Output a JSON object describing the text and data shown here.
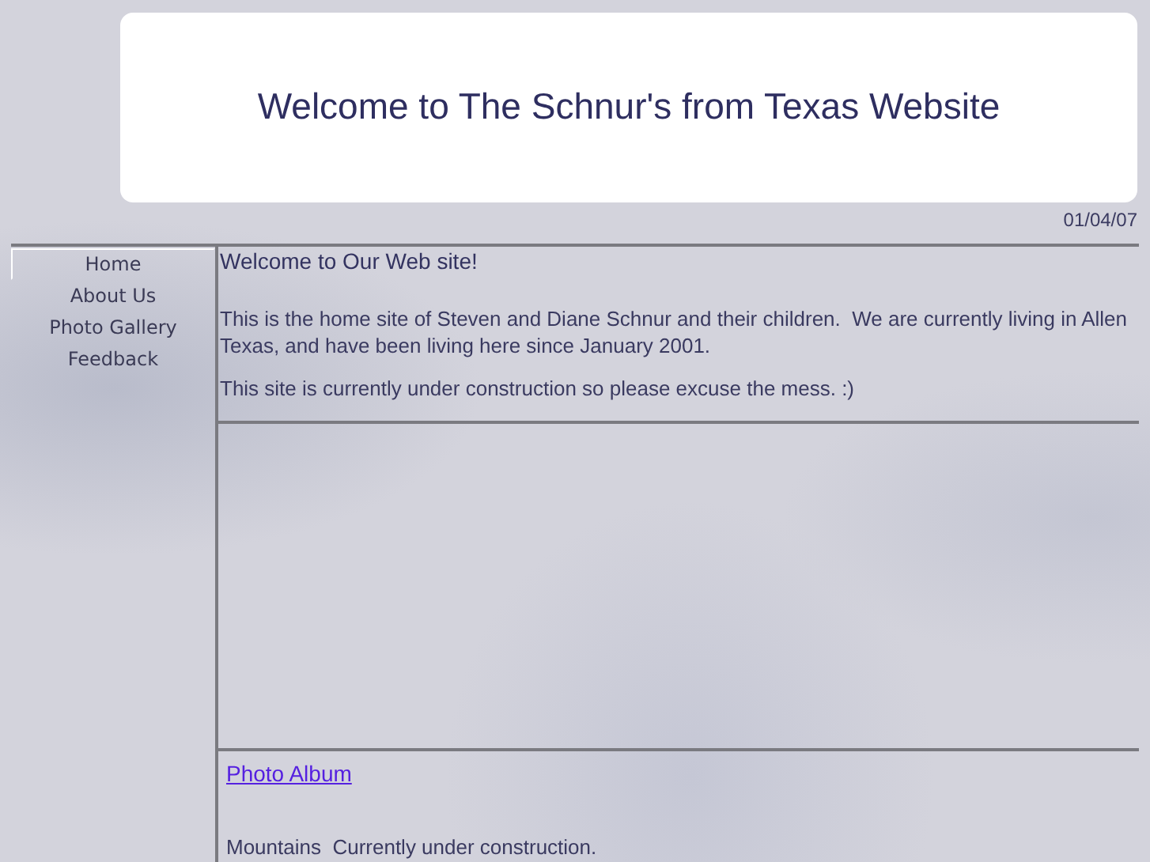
{
  "banner": {
    "title": "Welcome to The Schnur's from Texas Website"
  },
  "date": "01/04/07",
  "nav": [
    {
      "label": "Home",
      "selected": true
    },
    {
      "label": "About Us",
      "selected": false
    },
    {
      "label": "Photo Gallery",
      "selected": false
    },
    {
      "label": "Feedback",
      "selected": false
    }
  ],
  "main": {
    "heading": "Welcome to Our Web site!",
    "paragraphs": [
      "This is the home site of Steven and Diane Schnur and their children.  We are currently living in Allen Texas, and have been living here since January 2001.",
      "This site is currently under construction so please excuse the mess. :)"
    ]
  },
  "album": {
    "link": "Photo Album",
    "note": "Mountains  Currently under construction."
  }
}
